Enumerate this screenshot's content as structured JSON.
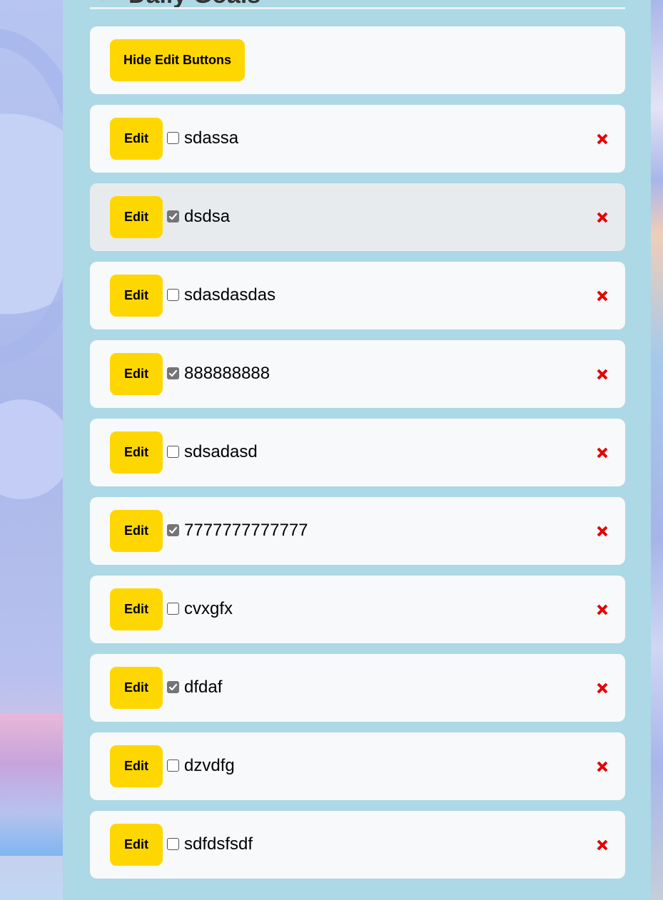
{
  "page": {
    "title": "Daily Goals"
  },
  "controls": {
    "toggle_label": "Hide Edit Buttons"
  },
  "tasks": [
    {
      "text": "sdassa",
      "done": false,
      "edit_label": "Edit"
    },
    {
      "text": "dsdsa",
      "done": true,
      "edit_label": "Edit"
    },
    {
      "text": "sdasdasdas",
      "done": false,
      "edit_label": "Edit"
    },
    {
      "text": "888888888",
      "done": true,
      "edit_label": "Edit"
    },
    {
      "text": "sdsadasd",
      "done": false,
      "edit_label": "Edit"
    },
    {
      "text": "7777777777777",
      "done": true,
      "edit_label": "Edit"
    },
    {
      "text": "cvxgfx",
      "done": false,
      "edit_label": "Edit"
    },
    {
      "text": "dfdaf",
      "done": true,
      "edit_label": "Edit"
    },
    {
      "text": "dzvdfg",
      "done": false,
      "edit_label": "Edit"
    },
    {
      "text": "sdfdsfsdf",
      "done": false,
      "edit_label": "Edit"
    }
  ],
  "colors": {
    "panel": "#add8e6",
    "card": "#f8f9fa",
    "card_highlight": "#e8ebee",
    "button": "#ffd700",
    "delete": "#e60000",
    "title_icon": "#f28a2e"
  },
  "icons": {
    "title": "sun-icon",
    "delete": "close-x-icon",
    "checkbox": "checkbox-icon"
  }
}
